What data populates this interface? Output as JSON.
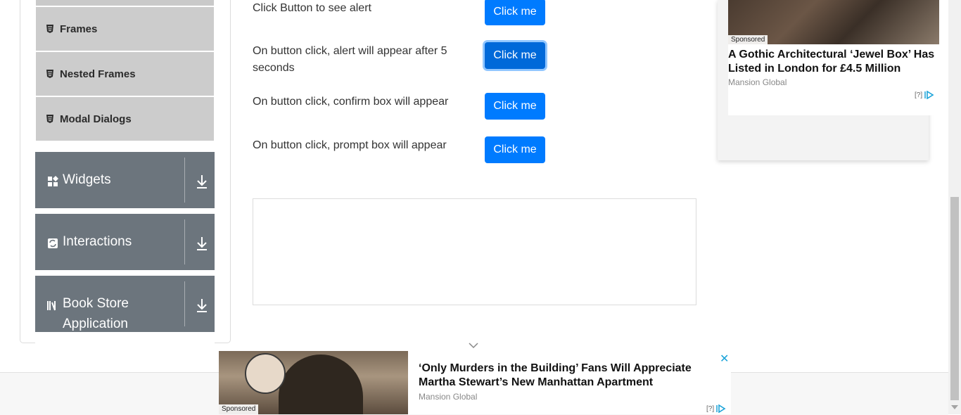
{
  "sidebar": {
    "sub_items": [
      {
        "label": "Frames",
        "icon": "html5-icon"
      },
      {
        "label": "Nested Frames",
        "icon": "html5-icon"
      },
      {
        "label": "Modal Dialogs",
        "icon": "html5-icon"
      }
    ],
    "groups": [
      {
        "label": "Widgets",
        "icon": "widgets-icon"
      },
      {
        "label": "Interactions",
        "icon": "interactions-icon"
      },
      {
        "label": "Book Store\nApplication",
        "label_line1": "Book Store",
        "label_line2": "Application",
        "icon": "books-icon"
      }
    ]
  },
  "alerts": {
    "rows": [
      {
        "text": "Click Button to see alert",
        "button": "Click me"
      },
      {
        "text_line1": "On button click, alert will appear after 5",
        "text_line2": "seconds",
        "button": "Click me"
      },
      {
        "text": "On button click, confirm box will appear",
        "button": "Click me"
      },
      {
        "text": "On button click, prompt box will appear",
        "button": "Click me"
      }
    ]
  },
  "right_ad": {
    "sponsored": "Sponsored",
    "title": "A Gothic Architectural ‘Jewel Box’ Has Listed in London for £4.5 Million",
    "source": "Mansion Global",
    "adchoice": "[?]"
  },
  "bottom_ad": {
    "sponsored": "Sponsored",
    "title": "‘Only Murders in the Building’ Fans Will Appreciate Martha Stewart’s New Manhattan Apartment",
    "source": "Mansion Global",
    "adchoice": "[?]",
    "close": "✕"
  },
  "colors": {
    "primary": "#007bff",
    "primary_focused": "#0069d9",
    "group_bg": "#6c757d",
    "sub_item_bg": "#cccccc",
    "adchoice": "#1aa3d9"
  }
}
